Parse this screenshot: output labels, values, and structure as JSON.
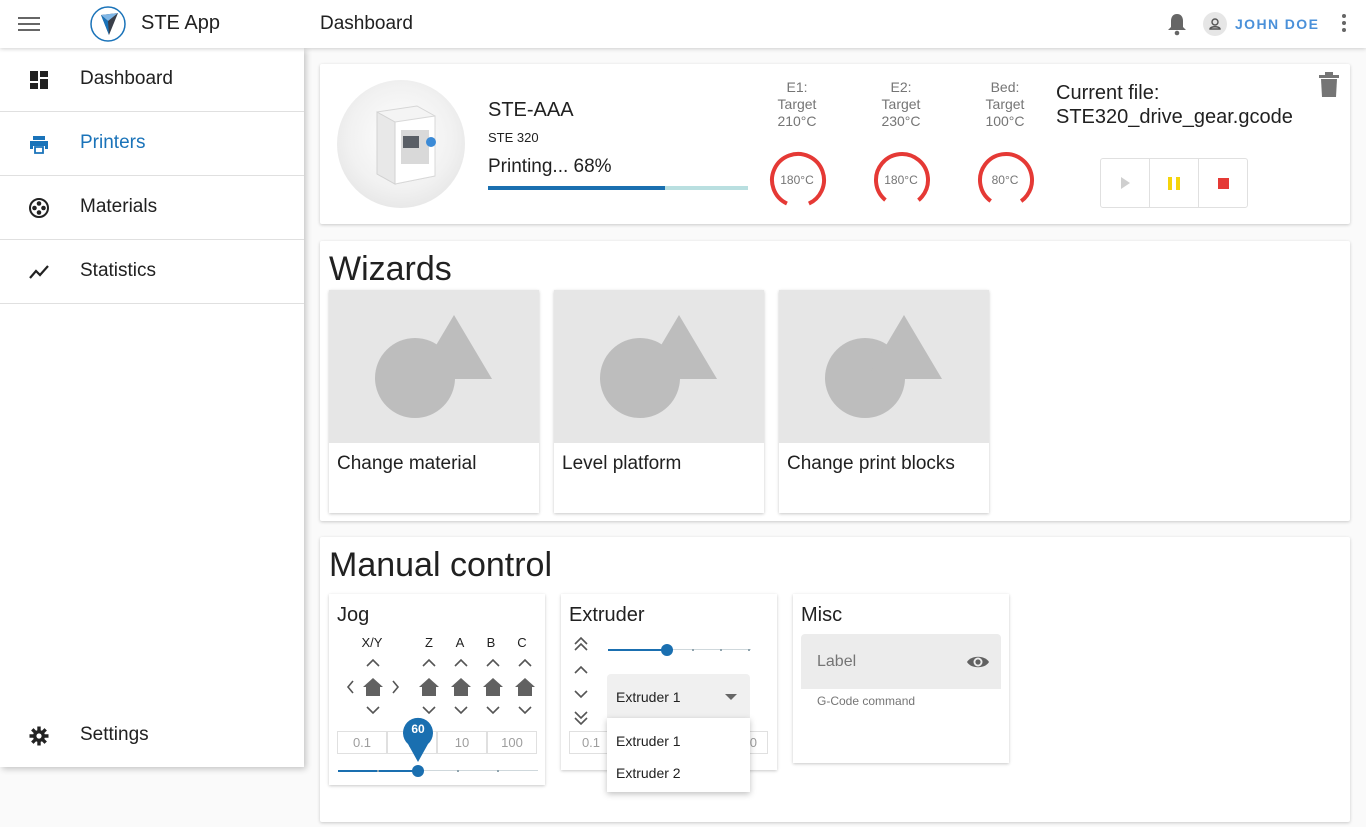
{
  "app": {
    "title": "STE App",
    "page_title": "Dashboard",
    "user_name": "JOHN DOE"
  },
  "sidebar": {
    "items": [
      {
        "label": "Dashboard",
        "icon": "dashboard-icon",
        "active": false
      },
      {
        "label": "Printers",
        "icon": "printer-icon",
        "active": true
      },
      {
        "label": "Materials",
        "icon": "film-reel-icon",
        "active": false
      },
      {
        "label": "Statistics",
        "icon": "trending-line-icon",
        "active": false
      }
    ],
    "settings": {
      "label": "Settings",
      "icon": "gear-icon"
    }
  },
  "printer": {
    "name": "STE-AAA",
    "model": "STE 320",
    "status": "Printing... 68%",
    "progress": 0.68,
    "temps": [
      {
        "label": "E1:",
        "target_label": "Target",
        "target": "210°C",
        "current": "180°C",
        "fraction": 0.86
      },
      {
        "label": "E2:",
        "target_label": "Target",
        "target": "230°C",
        "current": "180°C",
        "fraction": 0.78
      },
      {
        "label": "Bed:",
        "target_label": "Target",
        "target": "100°C",
        "current": "80°C",
        "fraction": 0.8
      }
    ],
    "current_file_label": "Current file:",
    "current_file": "STE320_drive_gear.gcode",
    "colors": {
      "gauge": "#e53935",
      "pause": "#f5d40b",
      "stop": "#e53935",
      "accent": "#1a6fb0"
    }
  },
  "wizards": {
    "title": "Wizards",
    "items": [
      {
        "label": "Change material"
      },
      {
        "label": "Level platform"
      },
      {
        "label": "Change print blocks"
      }
    ]
  },
  "manual": {
    "title": "Manual control",
    "jog": {
      "title": "Jog",
      "axes": [
        "X/Y",
        "Z",
        "A",
        "B",
        "C"
      ],
      "steps": [
        "0.1",
        "1",
        "10",
        "100"
      ],
      "slider_value": "60"
    },
    "extruder": {
      "title": "Extruder",
      "selected": "Extruder 1",
      "options": [
        "Extruder 1",
        "Extruder 2"
      ],
      "steps": [
        "0.1",
        "100"
      ]
    },
    "misc": {
      "title": "Misc",
      "field_label": "Label",
      "hint": "G-Code command"
    }
  }
}
